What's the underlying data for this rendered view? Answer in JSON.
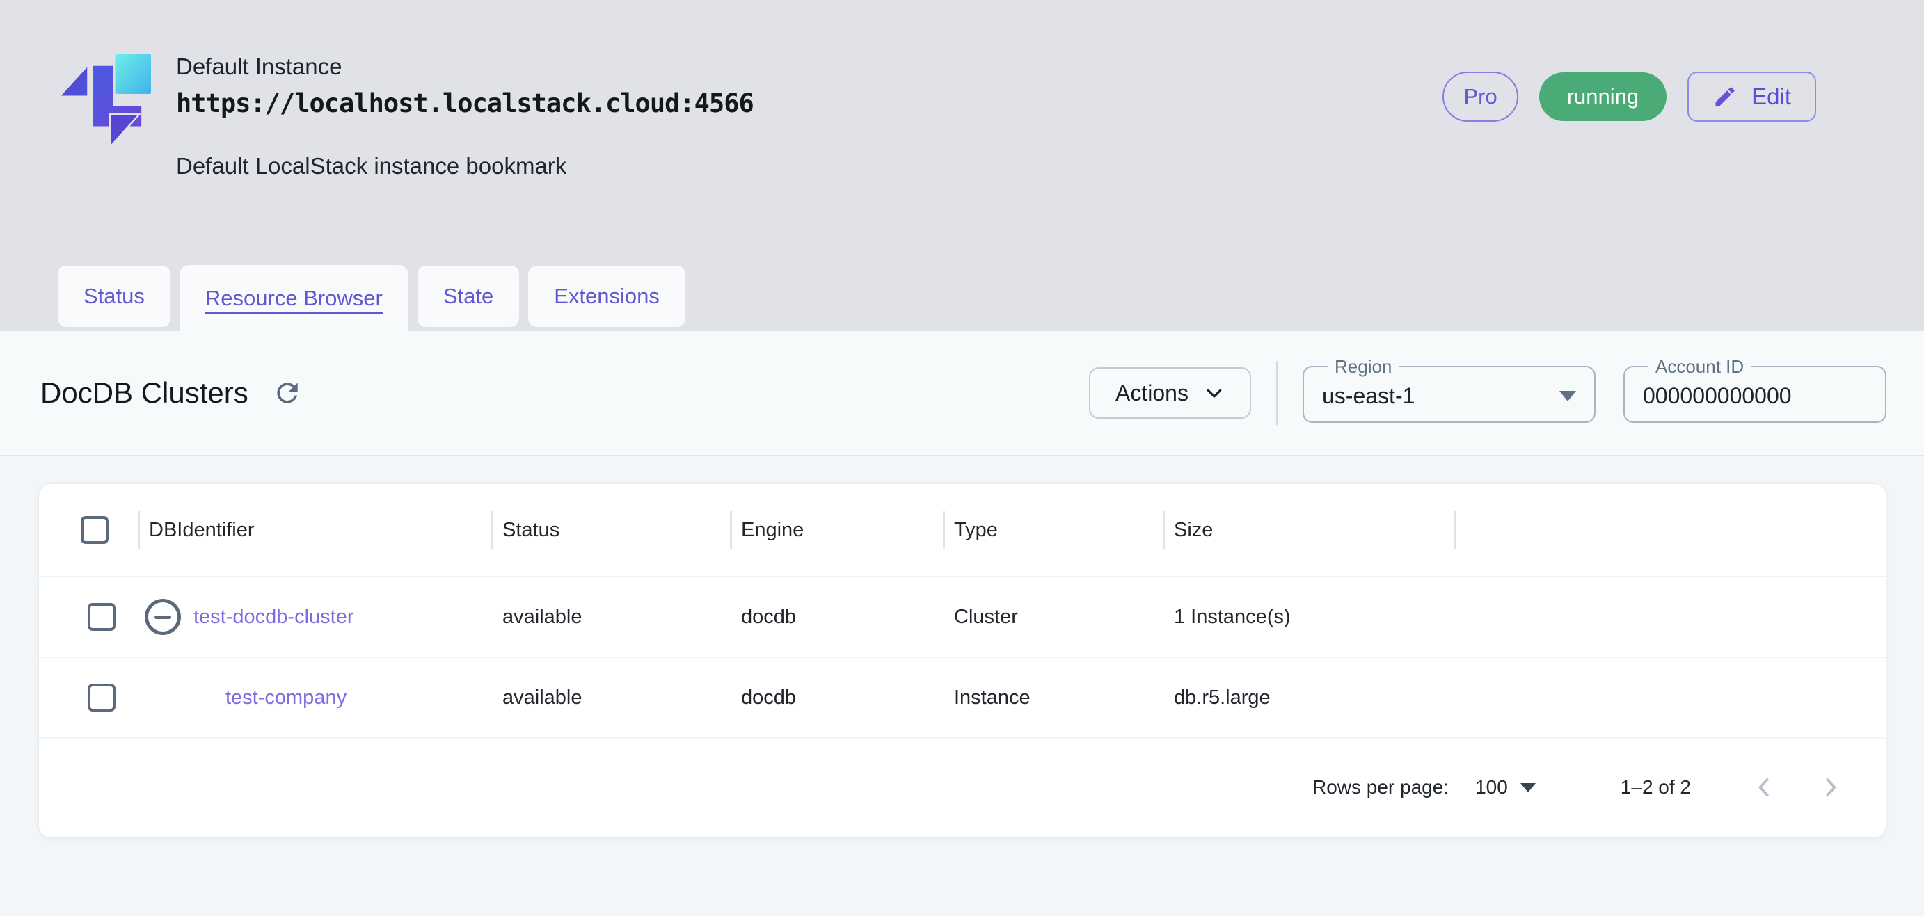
{
  "header": {
    "title": "Default Instance",
    "url": "https://localhost.localstack.cloud:4566",
    "subtitle": "Default LocalStack instance bookmark",
    "badges": {
      "plan": "Pro",
      "status": "running",
      "edit_label": "Edit"
    }
  },
  "tabs": [
    {
      "label": "Status"
    },
    {
      "label": "Resource Browser"
    },
    {
      "label": "State"
    },
    {
      "label": "Extensions"
    }
  ],
  "toolbar": {
    "heading": "DocDB Clusters",
    "actions_label": "Actions",
    "region": {
      "label": "Region",
      "value": "us-east-1"
    },
    "account": {
      "label": "Account ID",
      "value": "000000000000"
    }
  },
  "table": {
    "columns": [
      "DBIdentifier",
      "Status",
      "Engine",
      "Type",
      "Size"
    ],
    "rows": [
      {
        "id": "test-docdb-cluster",
        "status": "available",
        "engine": "docdb",
        "type": "Cluster",
        "size": "1 Instance(s)"
      },
      {
        "id": "test-company",
        "status": "available",
        "engine": "docdb",
        "type": "Instance",
        "size": "db.r5.large"
      }
    ]
  },
  "pagination": {
    "rows_per_page_label": "Rows per page:",
    "rows_per_page_value": "100",
    "range": "1–2 of 2"
  },
  "icons": {
    "logo": "localstack-logo",
    "edit": "pencil-icon",
    "refresh": "refresh-icon",
    "actions": "chevron-down-icon",
    "selects": "dropdown-arrow-icon",
    "prev": "chevron-left-icon",
    "next": "chevron-right-icon"
  },
  "colors": {
    "accent_purple": "#6456cf",
    "link_purple": "#7b6ee0",
    "status_green": "#4aab77",
    "header_gray": "#e0e2e7",
    "content_bg": "#f2f6f9"
  }
}
